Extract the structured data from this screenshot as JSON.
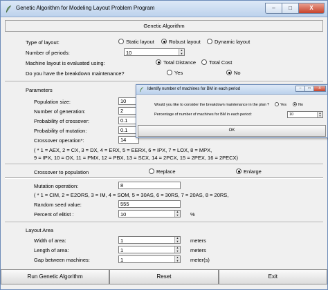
{
  "window": {
    "title": "Genetic Algorithm for Modeling Layout Problem Program",
    "controls": [
      "–",
      "□",
      "X"
    ]
  },
  "header": {
    "title": "Genetic Algorithm"
  },
  "layout_section": {
    "type_label": "Type of layout:",
    "type_options": [
      "Static layout",
      "Robust layout",
      "Dynamic layout"
    ],
    "periods_label": "Number of periods:",
    "periods_value": "10",
    "eval_label": "Machine layout is evaluated using:",
    "eval_options": [
      "Total Distance",
      "Total Cost"
    ],
    "breakdown_label": "Do you have the breakdown maintenance?",
    "breakdown_options": [
      "Yes",
      "No"
    ]
  },
  "parameters": {
    "title": "Parameters",
    "population_label": "Population size:",
    "population_value": "10",
    "generation_label": "Number of generation:",
    "generation_value": "2",
    "p_crossover_label": "Probability of crossover:",
    "p_crossover_value": "0.1",
    "p_mutation_label": "Probability of mutation:",
    "p_mutation_value": "0.1",
    "crossover_op_label": "Crossover operation*:",
    "crossover_op_value": "14",
    "crossover_legend": "( * 1 = AEX, 2 = CX, 3 = DX, 4 = ERX, 5 = EERX, 6 = IPX, 7 = LOX, 8 = MPX,\n 9 = IPX, 10 = OX, 11 = PMX, 12 = PBX, 13 = SCX, 14 = 2PCX, 15 = 2PEX, 16 = 2PECX)",
    "crossover_to_pop_label": "Crossover to population",
    "crossover_to_pop_options": [
      "Replace",
      "Enlarge"
    ],
    "mutation_label": "Mutation operation:",
    "mutation_value": "8",
    "mutation_legend": "( * 1 = CIM, 2 = E2ORS, 3 = IM, 4 = SOM, 5 = 30AS, 6 = 30RS, 7 = 20AS, 8 = 20RS,",
    "seed_label": "Random seed value:",
    "seed_value": "555",
    "elitist_label": "Percent of elitist :",
    "elitist_value": "10",
    "elitist_unit": "%"
  },
  "area": {
    "title": "Layout Area",
    "width_label": "Width of area:",
    "width_value": "1",
    "width_unit": "meters",
    "length_label": "Length of area:",
    "length_value": "1",
    "length_unit": "meters",
    "gap_label": "Gap between machines:",
    "gap_value": "1",
    "gap_unit": "meter(s)"
  },
  "buttons": {
    "run": "Run Genetic Algorithm",
    "reset": "Reset",
    "exit": "Exit"
  },
  "dialog": {
    "title": "Identify number of machines for BM in each period",
    "question": "Would you like to consider the breakdown maintenance in the plan ?",
    "options": [
      "Yes",
      "No"
    ],
    "percent_label": "Percentage of number of machines for BM in each period:",
    "percent_value": "10",
    "ok": "OK"
  }
}
